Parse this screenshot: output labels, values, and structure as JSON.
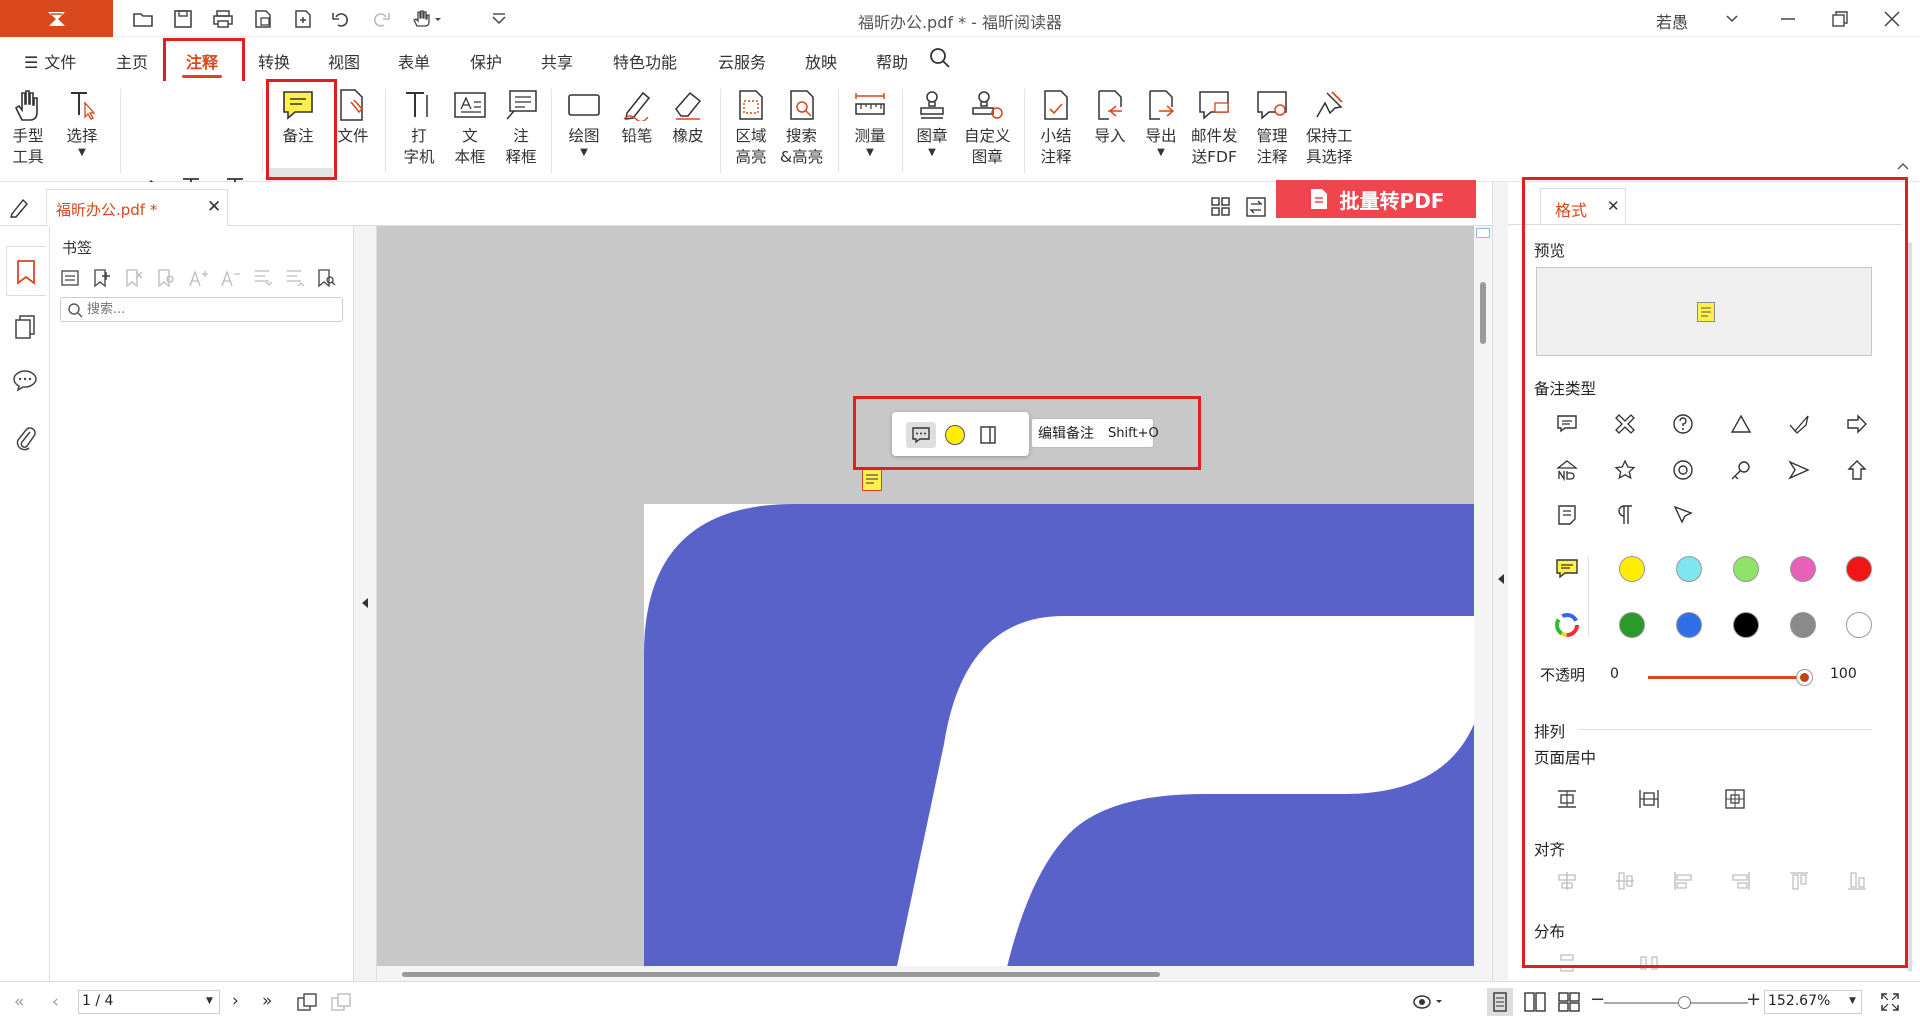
{
  "app": {
    "window_title": "福昕办公.pdf * - 福昕阅读器",
    "user": "若愚",
    "accent_color": "#d9471c",
    "logo_icon": "foxit-logo"
  },
  "menu": {
    "file": "文件",
    "items": [
      "主页",
      "注释",
      "转换",
      "视图",
      "表单",
      "保护",
      "共享",
      "特色功能",
      "云服务",
      "放映",
      "帮助"
    ],
    "active": "注释"
  },
  "ribbon": {
    "hand_tool": "手型\n工具",
    "select": "选择",
    "note": "备注",
    "file_attach": "文件",
    "typewriter": "打\n字机",
    "textbox": "文\n本框",
    "callout": "注\n释框",
    "drawing": "绘图",
    "pencil": "铅笔",
    "eraser": "橡皮",
    "area_highlight": "区域\n高亮",
    "search_highlight": "搜索\n&高亮",
    "measure": "测量",
    "stamp": "图章",
    "custom_stamp": "自定义\n图章",
    "summary": "小结\n注释",
    "import": "导入",
    "export": "导出",
    "email_fdf": "邮件发\n送FDF",
    "manage": "管理\n注释",
    "keep_tool": "保持工\n具选择"
  },
  "tabs": {
    "doc_tab": "福昕办公.pdf *",
    "batch_button": "批量转PDF"
  },
  "bookmarks": {
    "title": "书签",
    "search_placeholder": "搜索..."
  },
  "popup": {
    "edit_note": "编辑备注",
    "shortcut": "Shift+O"
  },
  "format_panel": {
    "tab": "格式",
    "preview": "预览",
    "note_type": "备注类型",
    "opacity_label": "不透明",
    "opacity_min": "0",
    "opacity_max": "100",
    "opacity_value": 1.0,
    "arrange": "排列",
    "page_center": "页面居中",
    "align": "对齐",
    "distribute": "分布",
    "colors": [
      "#ffee00",
      "#7fe5f0",
      "#8fe26a",
      "#e860b8",
      "#f01616",
      "#2a9a2a",
      "#2f6fe8",
      "#000000",
      "#8a8a8a",
      "#ffffff"
    ]
  },
  "status": {
    "page": "1 / 4",
    "zoom": "152.67%"
  }
}
